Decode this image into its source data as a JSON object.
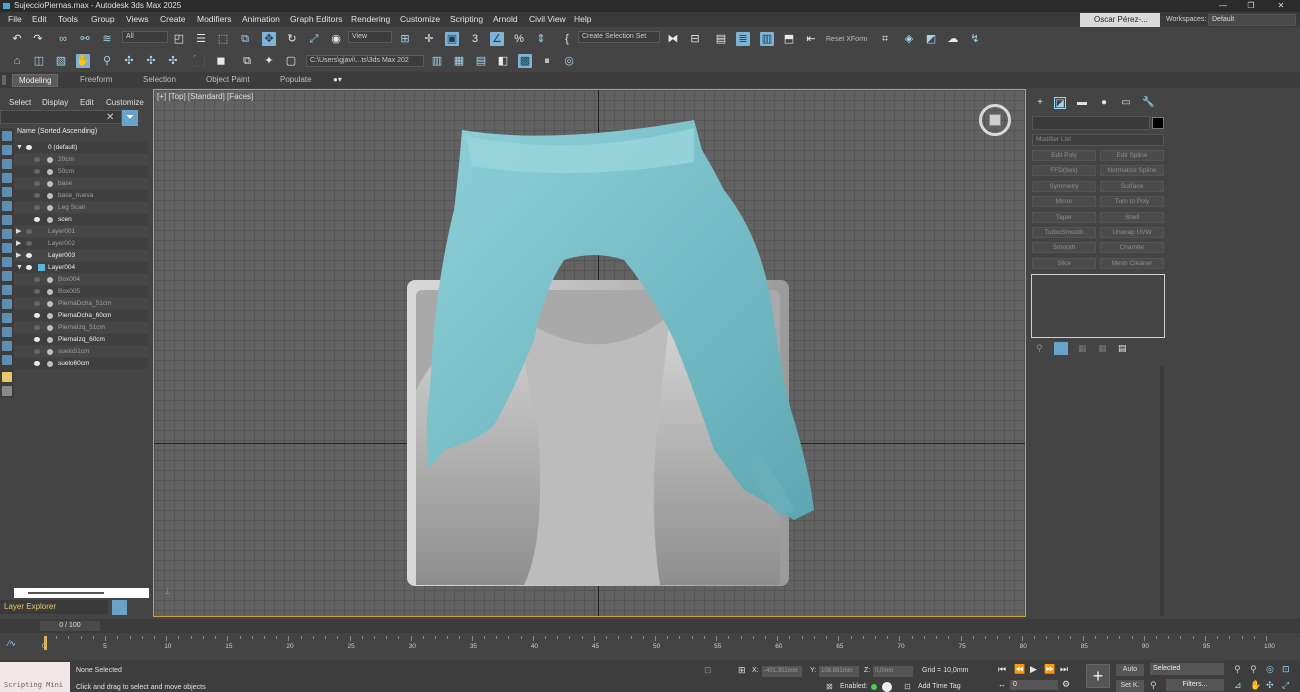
{
  "title_bar": {
    "title": "SujeccioPiernas.max - Autodesk 3ds Max 2025",
    "minimize": "—",
    "restore": "❐",
    "close": "✕"
  },
  "menu": [
    "File",
    "Edit",
    "Tools",
    "Group",
    "Views",
    "Create",
    "Modifiers",
    "Animation",
    "Graph Editors",
    "Rendering",
    "Customize",
    "Scripting",
    "Arnold",
    "Civil View",
    "Help"
  ],
  "user": "Oscar Pérez-...",
  "workspaces_label": "Workspaces:",
  "workspace": "Default",
  "toolbar": {
    "selection_filter": "All",
    "ref_coord": "View",
    "create_selection_set": "Create Selection Set",
    "reset_xform": "Reset XForm",
    "path": "C:\\Users\\gjavi\\...ts\\3ds Max 202"
  },
  "ribbon_tabs": [
    "Modeling",
    "Freeform",
    "Selection",
    "Object Paint",
    "Populate"
  ],
  "explorer": {
    "tabs": [
      "Select",
      "Display",
      "Edit",
      "Customize"
    ],
    "header": "Name (Sorted Ascending)",
    "rows": [
      {
        "label": "0 (default)",
        "level": 0,
        "expanded": true,
        "visible": true,
        "bright": true,
        "layer": false
      },
      {
        "label": "20cm",
        "level": 1,
        "visible": false,
        "bright": false
      },
      {
        "label": "50cm",
        "level": 1,
        "visible": false,
        "bright": false
      },
      {
        "label": "base",
        "level": 1,
        "visible": false,
        "bright": false
      },
      {
        "label": "base_nueva",
        "level": 1,
        "visible": false,
        "bright": false
      },
      {
        "label": "Leg Scan",
        "level": 1,
        "visible": false,
        "bright": false
      },
      {
        "label": "scen",
        "level": 1,
        "visible": true,
        "bright": true
      },
      {
        "label": "Layer001",
        "level": 0,
        "collapsed": true,
        "visible": false,
        "bright": false
      },
      {
        "label": "Layer002",
        "level": 0,
        "collapsed": true,
        "visible": false,
        "bright": false
      },
      {
        "label": "Layer003",
        "level": 0,
        "collapsed": true,
        "visible": true,
        "bright": true
      },
      {
        "label": "Layer004",
        "level": 0,
        "expanded": true,
        "visible": true,
        "bright": true,
        "layer": true
      },
      {
        "label": "Box004",
        "level": 1,
        "visible": false,
        "bright": false
      },
      {
        "label": "Box005",
        "level": 1,
        "visible": false,
        "bright": false
      },
      {
        "label": "PiernaDcha_51cm",
        "level": 1,
        "visible": false,
        "bright": false
      },
      {
        "label": "PiernaDcha_60cm",
        "level": 1,
        "visible": true,
        "bright": true
      },
      {
        "label": "PiernaIzq_51cm",
        "level": 1,
        "visible": false,
        "bright": false
      },
      {
        "label": "PiernaIzq_60cm",
        "level": 1,
        "visible": true,
        "bright": true
      },
      {
        "label": "suelo51cm",
        "level": 1,
        "visible": false,
        "bright": false
      },
      {
        "label": "suelo60cm",
        "level": 1,
        "visible": true,
        "bright": true
      }
    ],
    "layer_explorer": "Layer Explorer"
  },
  "viewport": {
    "label": "[+] [Top] [Standard] [Faces]"
  },
  "command_panel": {
    "modifier_list": "Modifier List",
    "modifiers": [
      "Edit Poly",
      "Edit Spline",
      "FFD(box)",
      "Normalize Spline",
      "Symmetry",
      "Surface",
      "Mirror",
      "Turn to Poly",
      "Taper",
      "Shell",
      "TurboSmooth",
      "Unwrap UVW",
      "Smooth",
      "Chamfer",
      "Slice",
      "Mesh Cleaner"
    ]
  },
  "time": {
    "frame_display": "0 / 100",
    "ticks": [
      "0",
      "5",
      "10",
      "15",
      "20",
      "25",
      "30",
      "35",
      "40",
      "45",
      "50",
      "55",
      "60",
      "65",
      "70",
      "75",
      "80",
      "85",
      "90",
      "95",
      "100"
    ]
  },
  "status": {
    "script_mini": "Scripting Mini",
    "selection": "None Selected",
    "prompt": "Click and drag to select and move objects",
    "x_label": "X:",
    "x_value": "-401,302mm",
    "y_label": "Y:",
    "y_value": "108,891mm",
    "z_label": "Z:",
    "z_value": "0,0mm",
    "grid": "Grid = 10,0mm",
    "enabled": "Enabled:",
    "add_time_tag": "Add Time Tag",
    "frame": "0",
    "auto": "Auto",
    "set_key": "Set K.",
    "selected": "Selected",
    "filters": "Filters..."
  },
  "colors": {
    "viewport_border": "#c7a23a",
    "mesh": "#7ec3cc",
    "accent": "#6aa3c8"
  }
}
